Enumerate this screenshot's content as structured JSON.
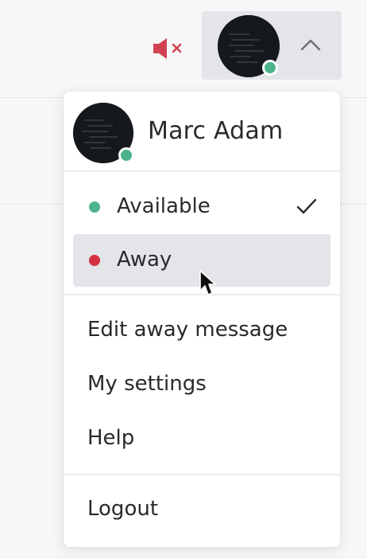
{
  "topbar": {
    "mute_icon": "speaker-muted-icon",
    "mute_color": "#d24150",
    "trigger_chevron_icon": "chevron-up-icon"
  },
  "user": {
    "name": "Marc Adam",
    "status_color": "#4db38c"
  },
  "menu": {
    "status_options": [
      {
        "label": "Available",
        "color": "#4db38c",
        "selected": true,
        "icon": "checkmark-icon"
      },
      {
        "label": "Away",
        "color": "#d63142",
        "hovered": true
      }
    ],
    "items": [
      {
        "label": "Edit away message"
      },
      {
        "label": "My settings"
      },
      {
        "label": "Help"
      }
    ],
    "logout_label": "Logout"
  }
}
